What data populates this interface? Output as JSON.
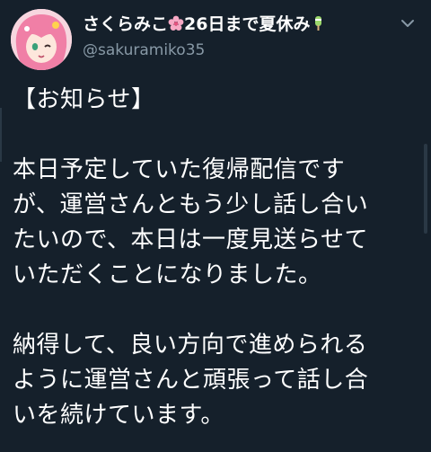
{
  "tweet": {
    "display_name": "さくらみこ",
    "display_name_suffix": "26日まで夏休み",
    "name_emoji_1": "cherry-blossom-icon",
    "name_emoji_2": "popsicle-icon",
    "handle": "@sakuramiko35",
    "lines": [
      "【お知らせ】",
      "",
      "本日予定していた復帰配信です",
      "が、運営さんともう少し話し合い",
      "たいので、本日は一度見送らせて",
      "いただくことになりました。",
      "",
      "納得して、良い方向で進められる",
      "ように運営さんと頑張って話し合",
      "いを続けています。"
    ]
  },
  "colors": {
    "background": "#15202b",
    "text": "#ffffff",
    "secondary_text": "#8899a6",
    "accent_pink": "#f39ab7"
  },
  "icons": {
    "menu": "chevron-down-icon",
    "avatar": "avatar"
  }
}
